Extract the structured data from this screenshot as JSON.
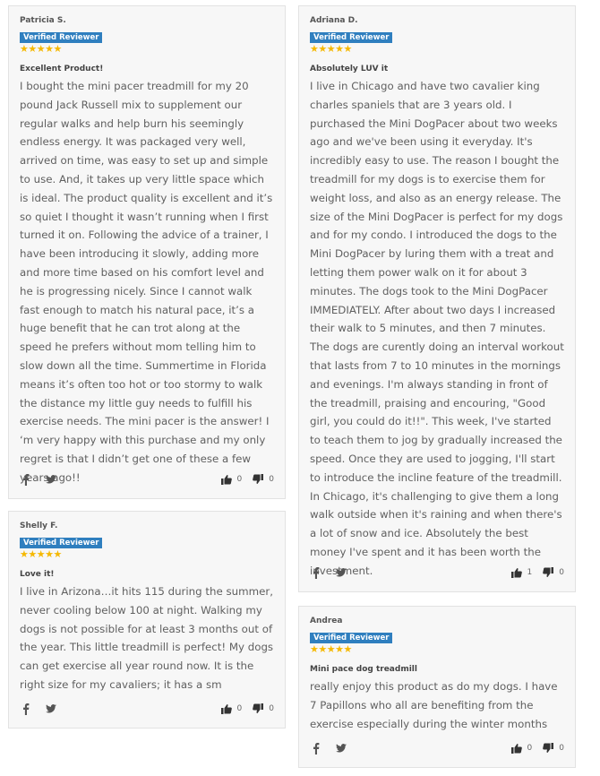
{
  "reviews": [
    {
      "name": "Patricia S.",
      "badge": "Verified Reviewer",
      "stars": "★★★★★",
      "title": "Excellent Product!",
      "body": "I bought the mini pacer treadmill for my 20 pound Jack Russell mix to supplement our regular walks and help burn his seemingly endless energy. It was packaged very well, arrived on time, was easy to set up and simple to use. And, it takes up very little space which is ideal. The product quality is excellent and it’s so quiet I thought it wasn’t running when I first turned it on. Following the advice of a trainer, I have been introducing it slowly, adding more and more time based on his comfort level and he is progressing nicely. Since I cannot walk fast enough to match his natural pace, it’s a huge benefit that he can trot along at the speed he prefers without mom telling him to slow down all the time. Summertime in Florida means it’s often too hot or too stormy to walk the distance my little guy needs to fulfill his exercise needs. The mini pacer is the answer! I ‘m very happy with this purchase and my only regret is that I didn’t get one of these a few years ago!!",
      "up": "0",
      "down": "0"
    },
    {
      "name": "Adriana D.",
      "badge": "Verified Reviewer",
      "stars": "★★★★★",
      "title": "Absolutely LUV it",
      "body": "I live in Chicago and have two cavalier king charles spaniels that are 3 years old. I purchased the Mini DogPacer about two weeks ago and we've been using it everyday. It's incredibly easy to use. The reason I bought the treadmill for my dogs is to exercise them for weight loss, and also as an energy release. The size of the Mini DogPacer is perfect for my dogs and for my condo. I introduced the dogs to the Mini DogPacer by luring them with a treat and letting them power walk on it for about 3 minutes. The dogs took to the Mini DogPacer IMMEDIATELY. After about two days I increased their walk to 5 minutes, and then 7 minutes. The dogs are curently doing an interval workout that lasts from 7 to 10 minutes in the mornings and evenings. I'm always standing in front of the treadmill, praising and encouring, \"Good girl, you could do it!!\". This week, I've started to teach them to jog by gradually increased the speed. Once they are used to jogging, I'll start to introduce the incline feature of the treadmill. In Chicago, it's challenging to give them a long walk outside when it's raining and when there's a lot of snow and ice. Absolutely the best money I've spent and it has been worth the investment.",
      "up": "1",
      "down": "0"
    },
    {
      "name": "Shelly F.",
      "badge": "Verified Reviewer",
      "stars": "★★★★★",
      "title": "Love it!",
      "body": "I live in Arizona…it hits 115 during the summer, never cooling below 100 at night. Walking my dogs is not possible for at least 3 months out of the year. This little treadmill is perfect! My dogs can get exercise all year round now. It is the right size for my cavaliers; it has a sm",
      "up": "0",
      "down": "0"
    },
    {
      "name": "Andrea",
      "badge": "Verified Reviewer",
      "stars": "★★★★★",
      "title": "Mini pace dog treadmill",
      "body": "really enjoy this product as do my dogs. I have 7 Papillons who all are benefiting from the exercise especially during the winter months",
      "up": "0",
      "down": "0"
    }
  ]
}
